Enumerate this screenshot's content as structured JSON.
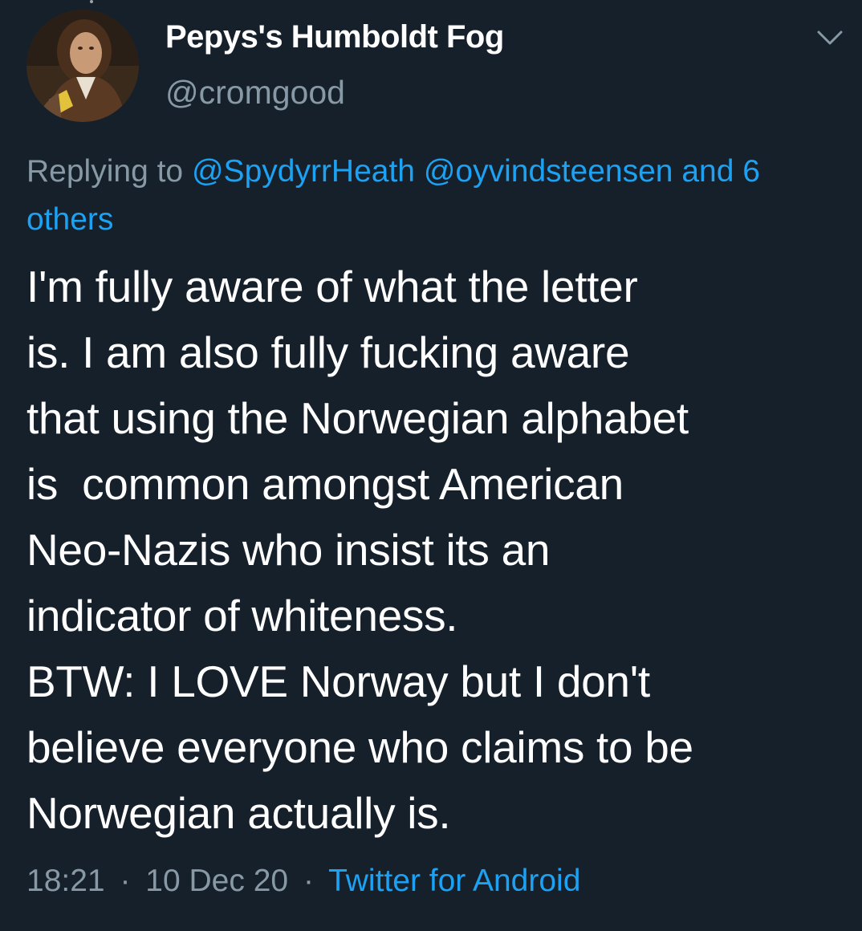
{
  "tweet": {
    "author": {
      "display_name": "Pepys's Humboldt Fog",
      "handle": "@cromgood",
      "avatar_icon": "portrait-avatar"
    },
    "menu_icon": "chevron-down-icon",
    "reply": {
      "prefix": "Replying to",
      "mentions": [
        "@SpydyrrHeath",
        "@oyvindsteensen"
      ],
      "connector": "and",
      "others": "6 others"
    },
    "text_lines": [
      "I'm fully aware of what the letter",
      "is. I am also fully fucking aware",
      "that using the Norwegian alphabet",
      "is  common amongst American",
      "Neo-Nazis who insist its an",
      "indicator of whiteness.",
      "BTW: I LOVE Norway but I don't",
      "believe everyone who claims to be",
      "Norwegian actually is."
    ],
    "meta": {
      "time": "18:21",
      "date": "10 Dec 20",
      "separator": "·",
      "source": "Twitter for Android"
    }
  },
  "colors": {
    "background": "#15202b",
    "text": "#ffffff",
    "secondary": "#8899a6",
    "link": "#1da1f2"
  }
}
